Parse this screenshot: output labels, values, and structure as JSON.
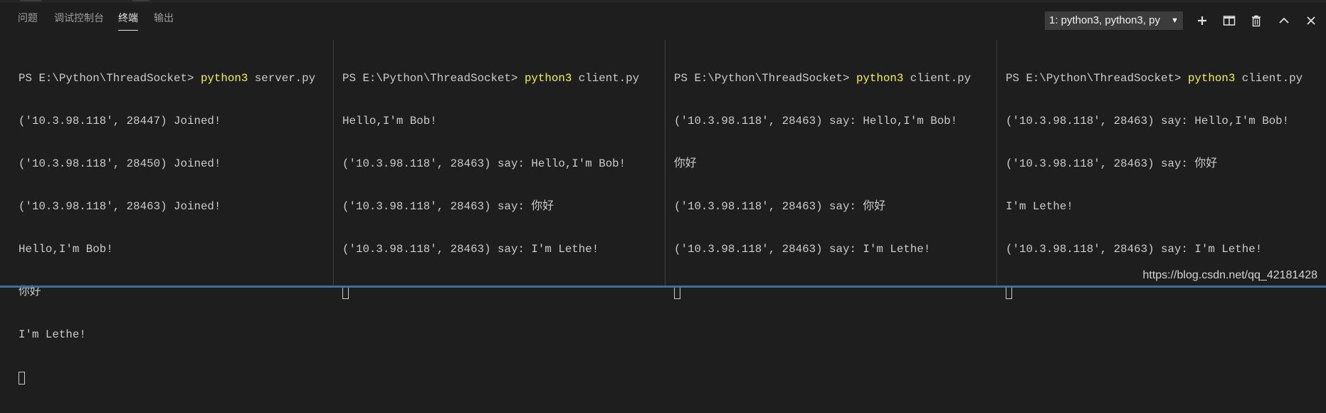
{
  "panel": {
    "tabs": [
      {
        "label": "问题"
      },
      {
        "label": "调试控制台"
      },
      {
        "label": "终端"
      },
      {
        "label": "输出"
      }
    ],
    "terminal_select": {
      "value": "1: python3, python3, py"
    },
    "icons": [
      "chevron-down-icon",
      "plus-icon",
      "split-icon",
      "trash-icon",
      "chevron-up-icon"
    ]
  },
  "terminals": [
    {
      "prompt": "PS E:\\Python\\ThreadSocket> ",
      "command": "python3",
      "argument": " server.py",
      "output": [
        "('10.3.98.118', 28447) Joined!",
        "('10.3.98.118', 28450) Joined!",
        "('10.3.98.118', 28463) Joined!",
        "Hello,I'm Bob!",
        "你好",
        "I'm Lethe!"
      ]
    },
    {
      "prompt": "PS E:\\Python\\ThreadSocket> ",
      "command": "python3",
      "argument": " client.py",
      "output": [
        "Hello,I'm Bob!",
        "('10.3.98.118', 28463) say: Hello,I'm Bob!",
        "('10.3.98.118', 28463) say: 你好",
        "('10.3.98.118', 28463) say: I'm Lethe!"
      ]
    },
    {
      "prompt": "PS E:\\Python\\ThreadSocket> ",
      "command": "python3",
      "argument": " client.py",
      "output": [
        "('10.3.98.118', 28463) say: Hello,I'm Bob!",
        "你好",
        "('10.3.98.118', 28463) say: 你好",
        "('10.3.98.118', 28463) say: I'm Lethe!"
      ]
    },
    {
      "prompt": "PS E:\\Python\\ThreadSocket> ",
      "command": "python3",
      "argument": " client.py",
      "output": [
        "('10.3.98.118', 28463) say: Hello,I'm Bob!",
        "('10.3.98.118', 28463) say: 你好",
        "I'm Lethe!",
        "('10.3.98.118', 28463) say: I'm Lethe!"
      ]
    }
  ],
  "watermark": "https://blog.csdn.net/qq_42181428",
  "colors": {
    "background": "#1e1e1e",
    "command": "#f5f543",
    "text": "#cccccc",
    "select_bg": "#3c3c3c"
  }
}
